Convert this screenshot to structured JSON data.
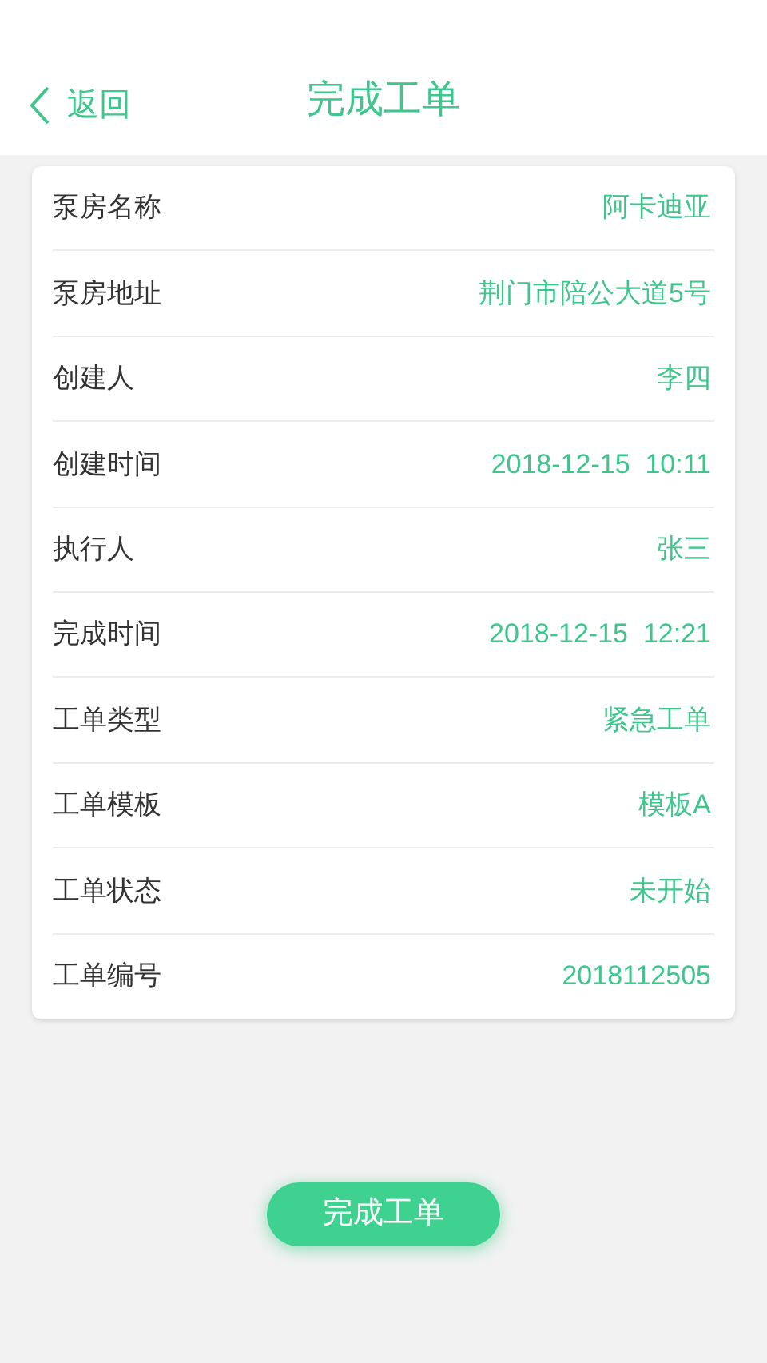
{
  "header": {
    "back_label": "返回",
    "title": "完成工单"
  },
  "fields": [
    {
      "label": "泵房名称",
      "value": "阿卡迪亚"
    },
    {
      "label": "泵房地址",
      "value": "荆门市陪公大道5号"
    },
    {
      "label": "创建人",
      "value": "李四"
    },
    {
      "label": "创建时间",
      "value": "2018-12-15  10:11"
    },
    {
      "label": "执行人",
      "value": "张三"
    },
    {
      "label": "完成时间",
      "value": "2018-12-15  12:21"
    },
    {
      "label": "工单类型",
      "value": "紧急工单"
    },
    {
      "label": "工单模板",
      "value": "模板A"
    },
    {
      "label": "工单状态",
      "value": "未开始"
    },
    {
      "label": "工单编号",
      "value": "2018112505"
    }
  ],
  "submit_button": "完成工单"
}
